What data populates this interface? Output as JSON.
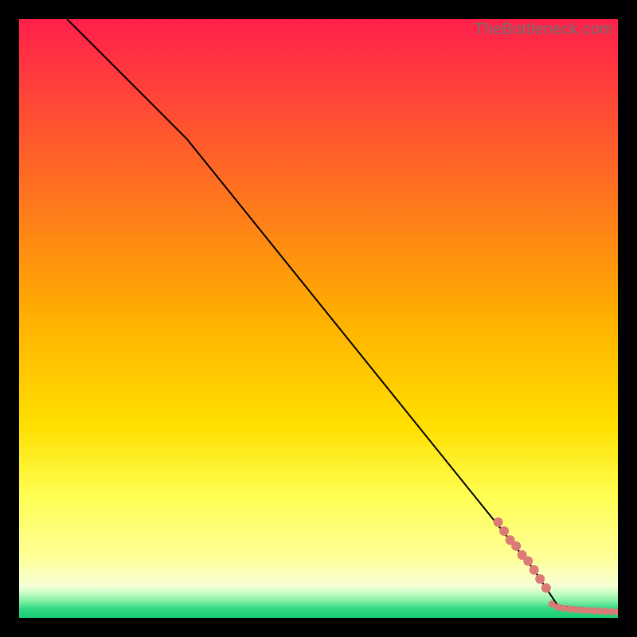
{
  "watermark": "TheBottleneck.com",
  "colors": {
    "gradient_top": "#ff1f4b",
    "gradient_mid": "#ffd400",
    "gradient_yellow": "#ffff66",
    "gradient_pale": "#ffffcc",
    "gradient_green": "#1fd87a",
    "frame_black": "#000000",
    "line": "#000000",
    "dot": "#db7a76"
  },
  "chart_data": {
    "type": "line",
    "title": "",
    "xlabel": "",
    "ylabel": "",
    "xlim": [
      0,
      100
    ],
    "ylim": [
      0,
      100
    ],
    "series": [
      {
        "name": "curve",
        "x": [
          8,
          28,
          86,
          90,
          100
        ],
        "y": [
          100,
          80,
          8,
          2,
          1
        ]
      }
    ],
    "scatter": [
      {
        "name": "tail-on-curve",
        "r": 6,
        "points": [
          {
            "x": 80,
            "y": 16
          },
          {
            "x": 81,
            "y": 14.5
          },
          {
            "x": 82,
            "y": 13
          },
          {
            "x": 83,
            "y": 12
          },
          {
            "x": 84,
            "y": 10.5
          },
          {
            "x": 85,
            "y": 9.5
          },
          {
            "x": 86,
            "y": 8
          },
          {
            "x": 87,
            "y": 6.5
          },
          {
            "x": 88,
            "y": 5
          }
        ]
      },
      {
        "name": "bottom-dots",
        "r": 4.5,
        "points": [
          {
            "x": 89,
            "y": 2.3
          },
          {
            "x": 90,
            "y": 1.8
          },
          {
            "x": 91,
            "y": 1.6
          },
          {
            "x": 92,
            "y": 1.5
          },
          {
            "x": 93,
            "y": 1.4
          },
          {
            "x": 94,
            "y": 1.3
          },
          {
            "x": 95,
            "y": 1.25
          },
          {
            "x": 96,
            "y": 1.2
          },
          {
            "x": 97,
            "y": 1.15
          },
          {
            "x": 98,
            "y": 1.1
          },
          {
            "x": 99,
            "y": 1.05
          },
          {
            "x": 100,
            "y": 1.0
          }
        ]
      }
    ],
    "background_bands": [
      {
        "stop": 0.0,
        "color": "#ff1f4b"
      },
      {
        "stop": 0.5,
        "color": "#ffb000"
      },
      {
        "stop": 0.68,
        "color": "#ffe000"
      },
      {
        "stop": 0.8,
        "color": "#ffff55"
      },
      {
        "stop": 0.9,
        "color": "#ffff99"
      },
      {
        "stop": 0.945,
        "color": "#f7ffd4"
      },
      {
        "stop": 0.955,
        "color": "#d8ffcf"
      },
      {
        "stop": 0.97,
        "color": "#8cf2a8"
      },
      {
        "stop": 0.985,
        "color": "#33d885"
      },
      {
        "stop": 1.0,
        "color": "#19cc72"
      }
    ]
  }
}
